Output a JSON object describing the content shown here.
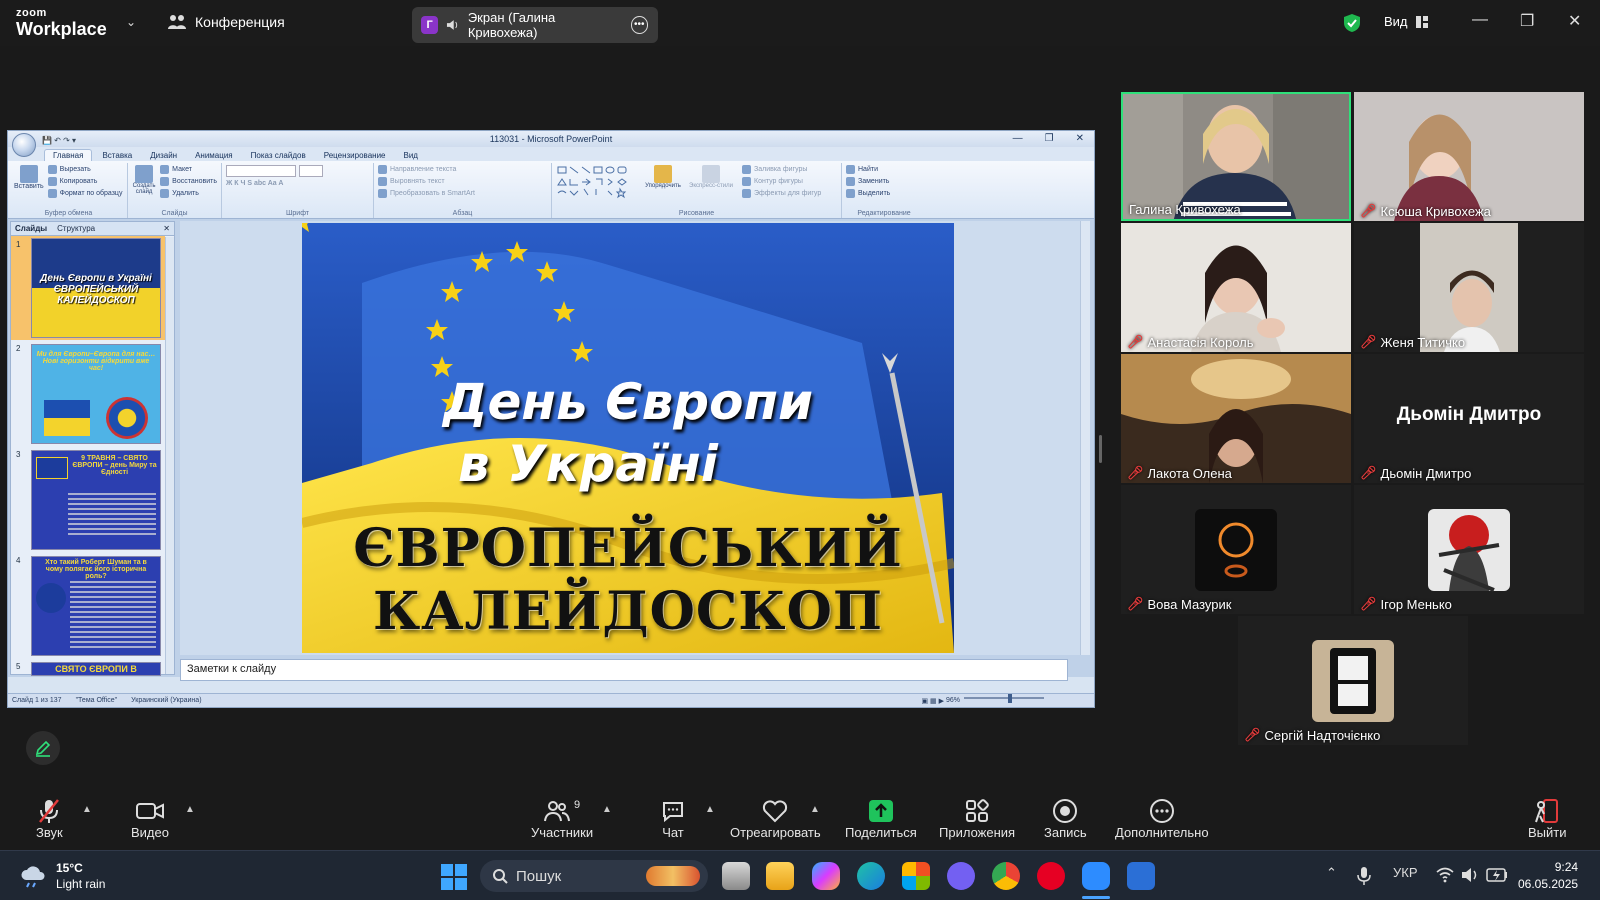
{
  "zoom": {
    "logo_line1": "zoom",
    "logo_line2": "Workplace",
    "meeting_title": "Конференция",
    "share_avatar_letter": "Г",
    "share_label": "Экран (Галина Кривохежа)",
    "view_label": "Вид",
    "accent_green": "#2fe07a",
    "muted_red": "#e23b3b"
  },
  "ppt": {
    "window_title": "113031 - Microsoft PowerPoint",
    "tabs": [
      "Главная",
      "Вставка",
      "Дизайн",
      "Анимация",
      "Показ слайдов",
      "Рецензирование",
      "Вид"
    ],
    "clipboard": {
      "paste": "Вставить",
      "cut": "Вырезать",
      "copy": "Копировать",
      "format": "Формат по образцу",
      "group": "Буфер обмена"
    },
    "slides_group": {
      "create": "Создать слайд",
      "layout": "Макет",
      "reset": "Восстановить",
      "delete": "Удалить",
      "group": "Слайды"
    },
    "font_group": "Шрифт",
    "paragraph": {
      "direction": "Направление текста",
      "align": "Выровнять текст",
      "smartart": "Преобразовать в SmartArt",
      "group": "Абзац"
    },
    "drawing": {
      "arrange": "Упорядочить",
      "styles": "Экспресс-стили",
      "fill": "Заливка фигуры",
      "outline": "Контур фигуры",
      "effects": "Эффекты для фигур",
      "group": "Рисование"
    },
    "editing": {
      "find": "Найти",
      "replace": "Заменить",
      "select": "Выделить",
      "group": "Редактирование"
    },
    "pane_tabs": {
      "slides": "Слайды",
      "outline": "Структура"
    },
    "thumbs": [
      {
        "num": "1",
        "text": "День Європи в Україні ЄВРОПЕЙСЬКИЙ КАЛЕЙДОСКОП"
      },
      {
        "num": "2",
        "text": "Ми для Європи–Європа для нас… Нові горизонти відкрити вже час!"
      },
      {
        "num": "3",
        "text": "9 ТРАВНЯ – СВЯТО ЄВРОПИ – день Миру та Єдності"
      },
      {
        "num": "4",
        "text": "Хто такий Роберт Шуман та в чому полягає його історична роль?"
      },
      {
        "num": "5",
        "text": "СВЯТО ЄВРОПИ В"
      }
    ],
    "slide": {
      "line1": "День Європи",
      "line2": "в Україні",
      "line3": "ЄВРОПЕЙСЬКИЙ",
      "line4": "КАЛЕЙДОСКОП"
    },
    "notes_placeholder": "Заметки к слайду",
    "status": {
      "slide_of": "Слайд 1 из 137",
      "theme": "\"Тема Office\"",
      "lang": "Украинский (Украина)",
      "zoom": "96%"
    }
  },
  "participants": [
    {
      "name": "Галина Кривохежа",
      "muted": false,
      "active": true
    },
    {
      "name": "Ксюша Кривохежа",
      "muted": true
    },
    {
      "name": "Анастасія Король",
      "muted": true
    },
    {
      "name": "Женя Титичко",
      "muted": true
    },
    {
      "name": "Лакота Олена",
      "muted": true
    },
    {
      "name": "Дьомін Дмитро",
      "muted": true,
      "big_name": "Дьомін Дмитро"
    },
    {
      "name": "Вова Мазурик",
      "muted": true
    },
    {
      "name": "Ігор Менько",
      "muted": true
    },
    {
      "name": "Сергій Надточієнко",
      "muted": true
    }
  ],
  "toolbar": {
    "audio": "Звук",
    "video": "Видео",
    "participants": "Участники",
    "participants_count": "9",
    "chat": "Чат",
    "react": "Отреагировать",
    "share": "Поделиться",
    "apps": "Приложения",
    "record": "Запись",
    "more": "Дополнительно",
    "leave": "Выйти"
  },
  "taskbar": {
    "temp": "15°C",
    "weather": "Light rain",
    "search": "Пошук",
    "lang": "УКР",
    "time": "9:24",
    "date": "06.05.2025"
  }
}
